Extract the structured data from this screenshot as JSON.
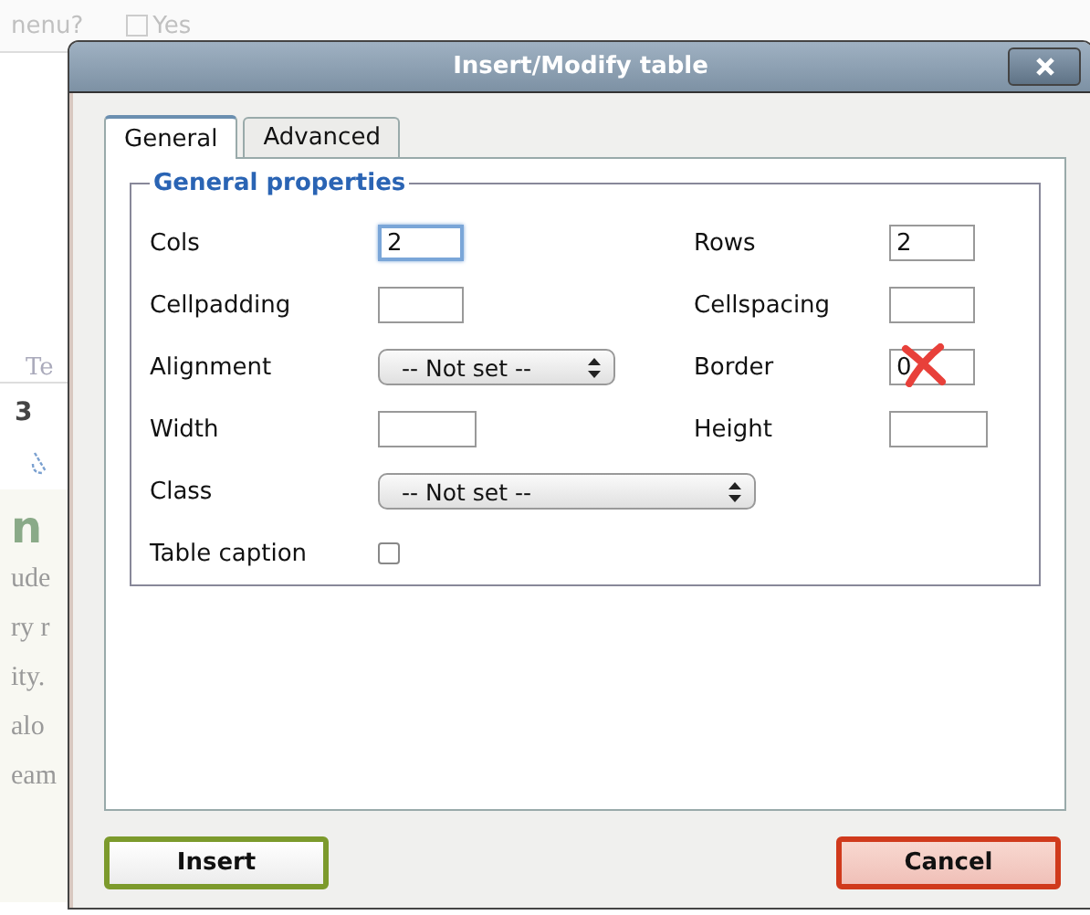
{
  "background_page": {
    "top_label": "nenu?",
    "checkbox": {
      "label": "Yes",
      "checked": false
    },
    "tab_fragment": "Te",
    "numeral": "3",
    "heading": "n",
    "text_lines": [
      "ude",
      "ry r",
      "ity.",
      "alo",
      "eam"
    ]
  },
  "dialog": {
    "title": "Insert/Modify table",
    "tabs": [
      {
        "label": "General",
        "selected": true
      },
      {
        "label": "Advanced",
        "selected": false
      }
    ],
    "legend": "General properties",
    "rows": [
      {
        "left": {
          "label": "Cols",
          "kind": "number",
          "value": "2",
          "focused": true
        },
        "right": {
          "label": "Rows",
          "kind": "number",
          "value": "2",
          "focused": false
        }
      },
      {
        "left": {
          "label": "Cellpadding",
          "kind": "number",
          "focused": false
        },
        "right": {
          "label": "Cellspacing",
          "kind": "number",
          "focused": false
        }
      },
      {
        "left": {
          "label": "Alignment",
          "kind": "select",
          "value": "-- Not set --"
        },
        "right": {
          "label": "Border",
          "kind": "number",
          "value": "0",
          "focused": false,
          "crossed_out": true
        }
      },
      {
        "left": {
          "label": "Width",
          "kind": "size",
          "focused": false
        },
        "right": {
          "label": "Height",
          "kind": "size",
          "focused": false
        }
      },
      {
        "left": {
          "label": "Class",
          "kind": "select",
          "value": "-- Not set --"
        }
      },
      {
        "left": {
          "label": "Table caption",
          "kind": "checkbox",
          "checked": false
        }
      }
    ],
    "buttons": [
      {
        "label": "Insert",
        "kind": "insert"
      },
      {
        "label": "Cancel",
        "kind": "cancel"
      }
    ]
  }
}
